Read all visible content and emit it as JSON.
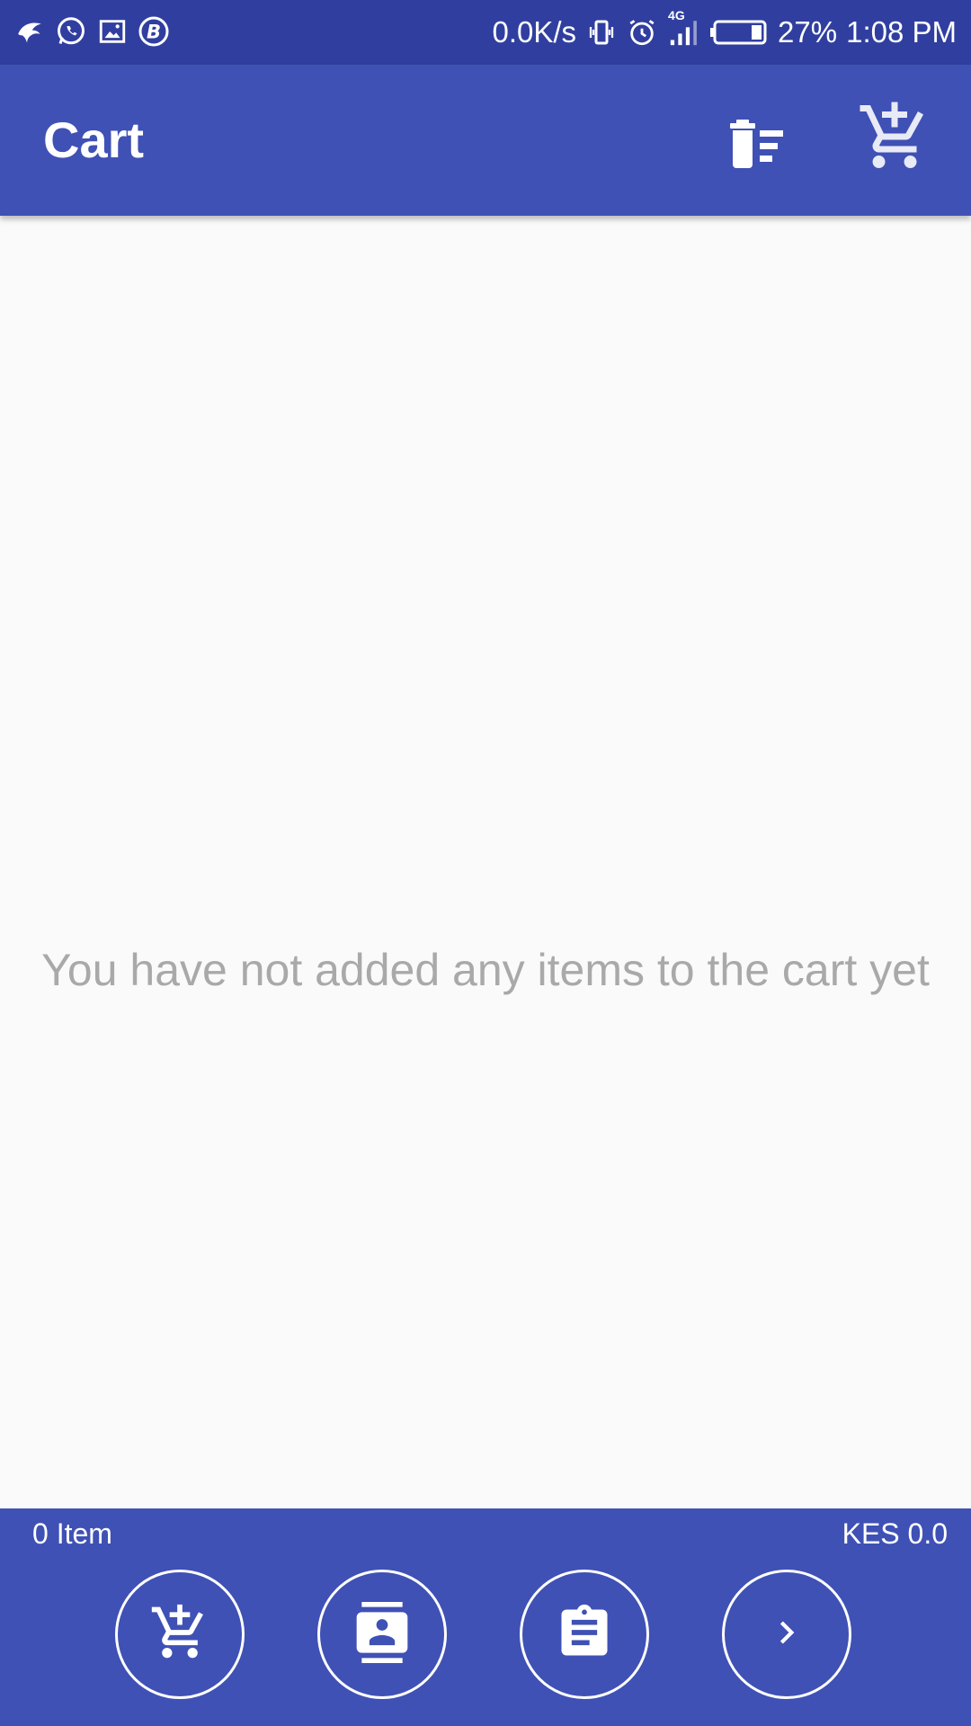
{
  "status_bar": {
    "network_speed": "0.0K/s",
    "network_type": "4G",
    "battery": "27%",
    "time": "1:08 PM",
    "icons": [
      "bird-app-icon",
      "whatsapp-icon",
      "screencast-icon",
      "bbm-icon",
      "vibrate-icon",
      "alarm-icon",
      "signal-icon",
      "battery-icon"
    ]
  },
  "app_bar": {
    "title": "Cart",
    "actions": [
      "clear-cart-icon",
      "add-to-cart-icon"
    ]
  },
  "main": {
    "empty_message": "You have not added any items to the cart yet"
  },
  "bottom_bar": {
    "item_count": "0 Item",
    "total": "KES 0.0",
    "buttons": [
      "add-to-cart-icon",
      "contact-icon",
      "clipboard-icon",
      "chevron-right-icon"
    ]
  },
  "colors": {
    "status_bar": "#303f9f",
    "primary": "#3f51b5",
    "background": "#fafafa",
    "empty_text": "#a9a9a9"
  }
}
